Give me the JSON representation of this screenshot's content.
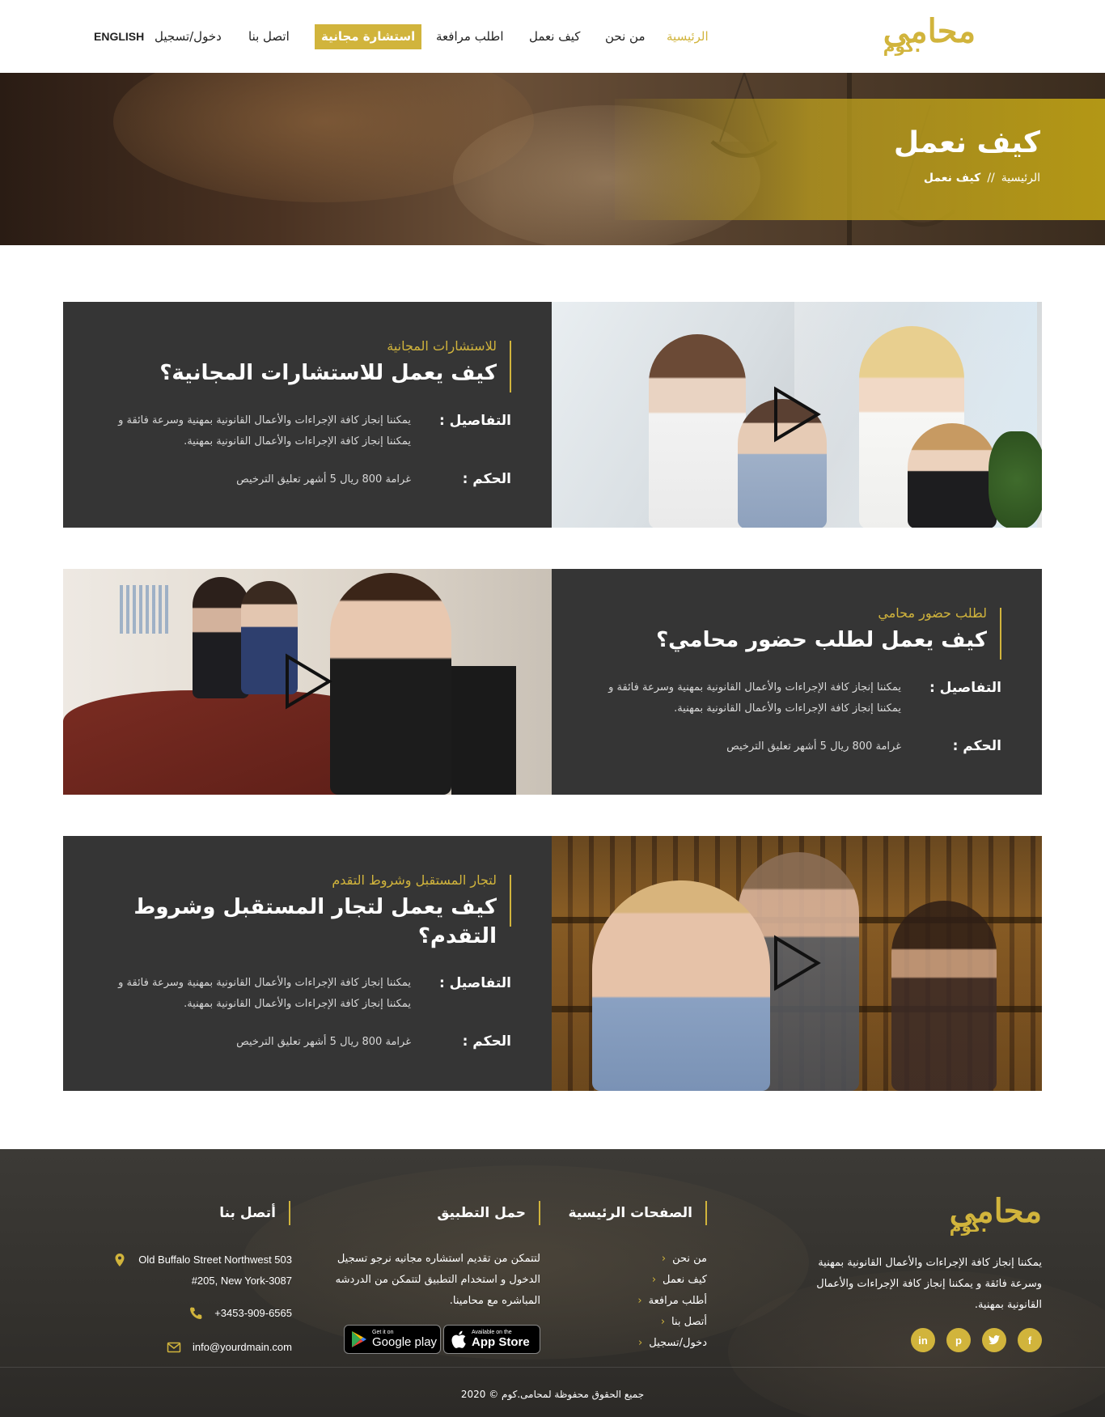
{
  "brand": {
    "name": "محامى",
    "suffix": ".كوم"
  },
  "nav": {
    "home": "الرئيسية",
    "about": "من نحن",
    "how": "كيف نعمل",
    "plead": "اطلب مرافعة",
    "consult": "استشارة مجانية",
    "contact": "اتصل بنا",
    "login": "دخول/تسجيل",
    "lang": "ENGLISH"
  },
  "hero": {
    "title": "كيف نعمل",
    "breadcrumb": {
      "home": "الرئيسية",
      "sep": "//",
      "current": "كيف نعمل"
    }
  },
  "services": [
    {
      "subtitle": "للاستشارات المجانية",
      "heading": "كيف يعمل للاستشارات المجانية؟",
      "details_label": "التفاصيل :",
      "details": "يمكننا إنجاز كافة الإجراءات والأعمال القانونية بمهنية وسرعة فائقة و يمكننا إنجاز كافة الإجراءات والأعمال القانونية بمهنية.",
      "ruling_label": "الحكم :",
      "ruling": "غرامة 800 ريال 5 أشهر تعليق الترخيص"
    },
    {
      "subtitle": "لطلب حضور محامي",
      "heading": "كيف يعمل لطلب حضور محامي؟",
      "details_label": "التفاصيل :",
      "details": "يمكننا إنجاز كافة الإجراءات والأعمال القانونية بمهنية وسرعة فائقة و يمكننا إنجاز كافة الإجراءات والأعمال القانونية بمهنية.",
      "ruling_label": "الحكم :",
      "ruling": "غرامة 800 ريال 5 أشهر تعليق الترخيص"
    },
    {
      "subtitle": "لتجار المستقبل وشروط التقدم",
      "heading": "كيف يعمل لتجار المستقبل وشروط التقدم؟",
      "details_label": "التفاصيل :",
      "details": "يمكننا إنجاز كافة الإجراءات والأعمال القانونية بمهنية وسرعة فائقة و يمكننا إنجاز كافة الإجراءات والأعمال القانونية بمهنية.",
      "ruling_label": "الحكم :",
      "ruling": "غرامة 800 ريال 5 أشهر تعليق الترخيص"
    }
  ],
  "footer": {
    "about_text": "يمكننا إنجاز كافة الإجراءات والأعمال القانونية بمهنية وسرعة فائقة و يمكننا إنجاز كافة الإجراءات والأعمال القانونية بمهنية.",
    "pages_title": "الصفحات الرئيسية",
    "pages": [
      "من نحن",
      "كيف نعمل",
      "أطلب مرافعة",
      "أتصل بنا",
      "دخول/تسجيل"
    ],
    "app_title": "حمل التطبيق",
    "app_text": "لتتمكن من تقديم استشاره مجانيه نرجو تسجيل الدخول و استخدام التطبيق لتتمكن من الدردشه المباشره مع محامينا.",
    "contact_title": "أتصل بنا",
    "address_line1": "Old Buffalo Street Northwest 503",
    "address_line2": "#205, New York-3087",
    "phone": "+3453-909-6565",
    "email": "info@yourdmain.com",
    "google_small": "Get it on",
    "google_big": "Google play",
    "apple_small": "Available on the",
    "apple_big": "App Store",
    "social": [
      "f",
      "t",
      "p",
      "in"
    ],
    "copyright": "جميع الحقوق محفوظة لمحامى.كوم © 2020"
  },
  "colors": {
    "accent": "#d1b43c",
    "panel": "#353535",
    "footer": "#36342f"
  }
}
